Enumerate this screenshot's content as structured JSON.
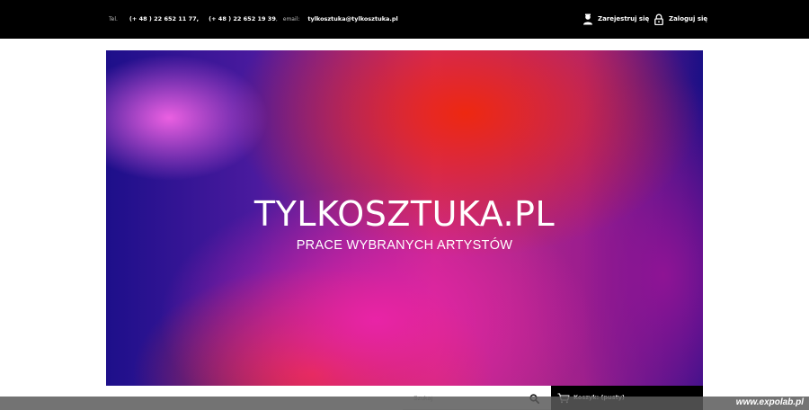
{
  "topbar": {
    "phone_label": "Tel.",
    "phone_1": "(+ 48 ) 22 652 11 77",
    "separator": ",",
    "phone_2": "(+ 48 ) 22 652 19 39",
    "email_label": "email:",
    "email": "tylkosztuka@tylkosztuka.pl",
    "register_label": "Zarejestruj się",
    "register_icon": "user-add-icon",
    "login_label": "Zaloguj się",
    "login_icon": "lock-icon"
  },
  "hero": {
    "title": "TYLKOSZTUKA.PL",
    "subtitle": "PRACE WYBRANYCH ARTYSTÓW"
  },
  "search": {
    "placeholder": "Szukaj",
    "icon": "search-icon"
  },
  "cart": {
    "label": "Koszyk: (pusty)",
    "icon": "cart-icon"
  },
  "watermark": {
    "text": "www.expolab.pl"
  },
  "colors": {
    "topbar_bg": "#000000",
    "cart_bg": "#000000",
    "text_light": "#ffffff"
  }
}
